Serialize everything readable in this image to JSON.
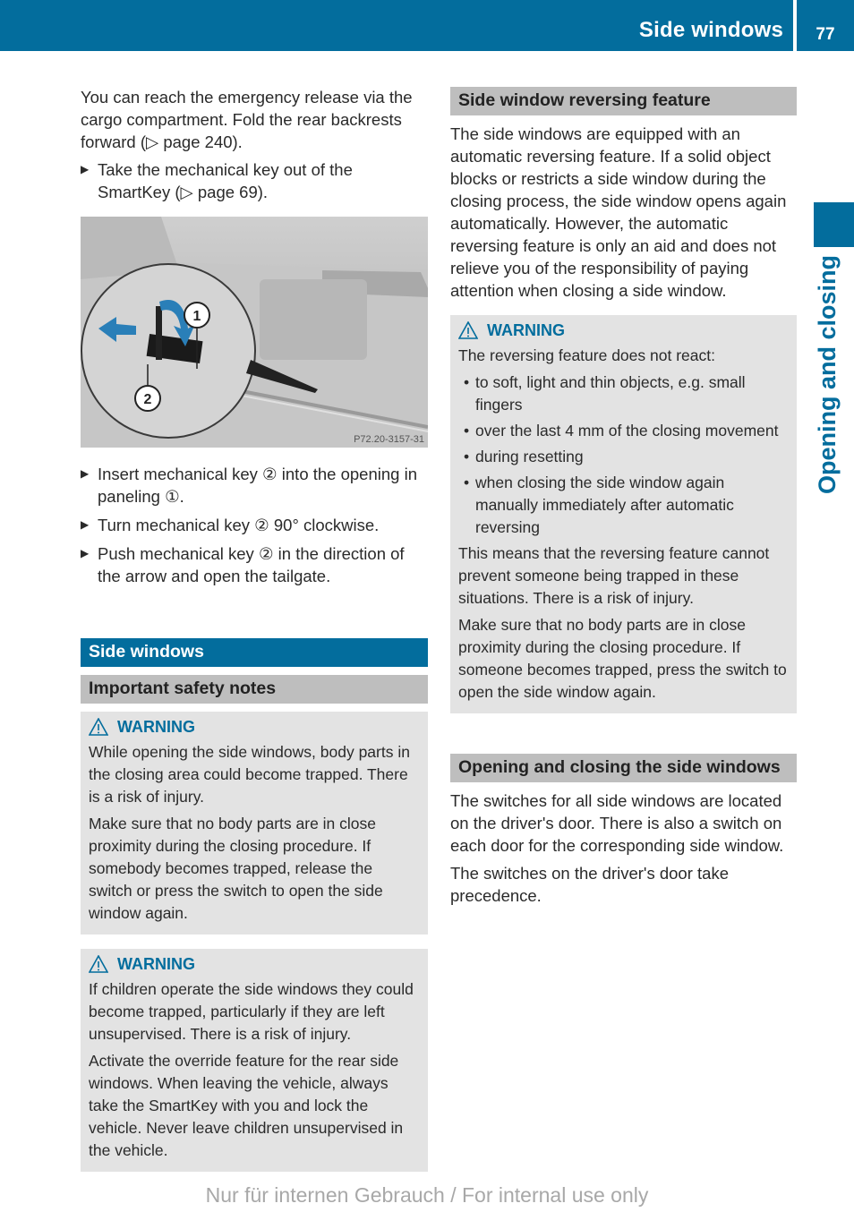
{
  "header": {
    "section_title": "Side windows",
    "page_number": "77"
  },
  "side_tab": {
    "label": "Opening and closing"
  },
  "left_column": {
    "intro": "You can reach the emergency release via the cargo compartment. Fold the rear backrests forward (▷ page 240).",
    "step_1": "Take the mechanical key out of the SmartKey (▷ page 69).",
    "figure": {
      "callout_1": "1",
      "callout_2": "2",
      "figure_code": "P72.20-3157-31"
    },
    "steps_after_figure": [
      "Insert mechanical key ② into the opening in paneling ①.",
      "Turn mechanical key ② 90° clockwise.",
      "Push mechanical key ② in the direction of the arrow and open the tailgate."
    ],
    "section_heading": "Side windows",
    "subheading": "Important safety notes",
    "warning_1": {
      "label": "WARNING",
      "paragraphs": [
        "While opening the side windows, body parts in the closing area could become trapped. There is a risk of injury.",
        "Make sure that no body parts are in close proximity during the closing procedure. If somebody becomes trapped, release the switch or press the switch to open the side window again."
      ]
    },
    "warning_2": {
      "label": "WARNING",
      "paragraphs": [
        "If children operate the side windows they could become trapped, particularly if they are left unsupervised. There is a risk of injury.",
        "Activate the override feature for the rear side windows. When leaving the vehicle, always take the SmartKey with you and lock the vehicle. Never leave children unsupervised in the vehicle."
      ]
    }
  },
  "right_column": {
    "reversing_heading": "Side window reversing feature",
    "reversing_text": "The side windows are equipped with an automatic reversing feature. If a solid object blocks or restricts a side window during the closing process, the side window opens again automatically. However, the automatic reversing feature is only an aid and does not relieve you of the responsibility of paying attention when closing a side window.",
    "warning_3": {
      "label": "WARNING",
      "intro": "The reversing feature does not react:",
      "bullets": [
        "to soft, light and thin objects, e.g. small fingers",
        "over the last 4 mm of the closing movement",
        "during resetting",
        "when closing the side window again manually immediately after automatic reversing"
      ],
      "paragraphs": [
        "This means that the reversing feature cannot prevent someone being trapped in these situations. There is a risk of injury.",
        "Make sure that no body parts are in close proximity during the closing procedure. If someone becomes trapped, press the switch to open the side window again."
      ]
    },
    "opening_heading": "Opening and closing the side windows",
    "opening_paragraphs": [
      "The switches for all side windows are located on the driver's door. There is also a switch on each door for the corresponding side window.",
      "The switches on the driver's door take precedence."
    ]
  },
  "footer": {
    "watermark": "Nur für internen Gebrauch / For internal use only"
  },
  "colors": {
    "brand_blue": "#036d9d",
    "subheading_gray": "#bebebe",
    "warning_bg": "#e3e3e3"
  }
}
